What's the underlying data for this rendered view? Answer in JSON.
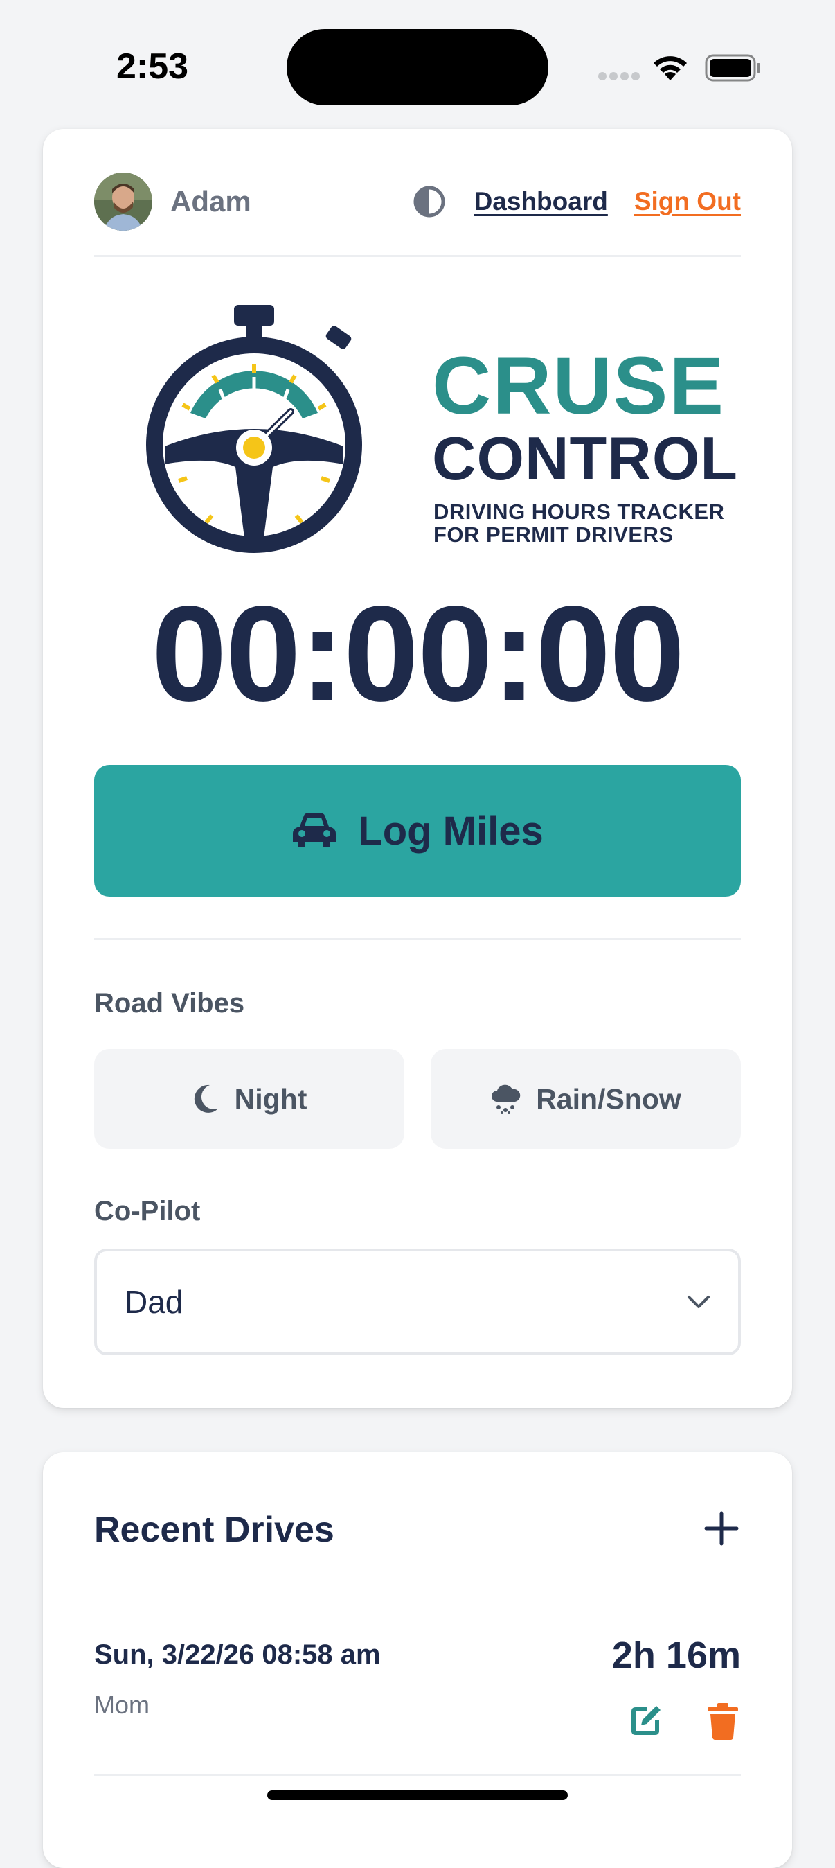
{
  "status_bar": {
    "time": "2:53"
  },
  "header": {
    "user_name": "Adam",
    "dashboard_label": "Dashboard",
    "sign_out_label": "Sign Out"
  },
  "logo": {
    "line1": "CRUSE",
    "line2": "CONTROL",
    "subtitle_line1": "DRIVING HOURS TRACKER",
    "subtitle_line2": "FOR PERMIT DRIVERS"
  },
  "timer": {
    "value": "00:00:00"
  },
  "log_button": {
    "label": "Log Miles",
    "icon": "car-icon"
  },
  "road_vibes": {
    "label": "Road Vibes",
    "options": [
      {
        "label": "Night",
        "icon": "moon-icon"
      },
      {
        "label": "Rain/Snow",
        "icon": "cloud-rain-icon"
      }
    ]
  },
  "co_pilot": {
    "label": "Co-Pilot",
    "selected": "Dad"
  },
  "recent_drives": {
    "title": "Recent Drives",
    "items": [
      {
        "date": "Sun, 3/22/26 08:58 am",
        "co_pilot": "Mom",
        "duration": "2h 16m"
      }
    ]
  },
  "colors": {
    "navy": "#1e2a4a",
    "teal": "#2ba5a1",
    "logo_teal": "#2b8f8a",
    "orange": "#f26d21",
    "gold": "#f5c518"
  }
}
